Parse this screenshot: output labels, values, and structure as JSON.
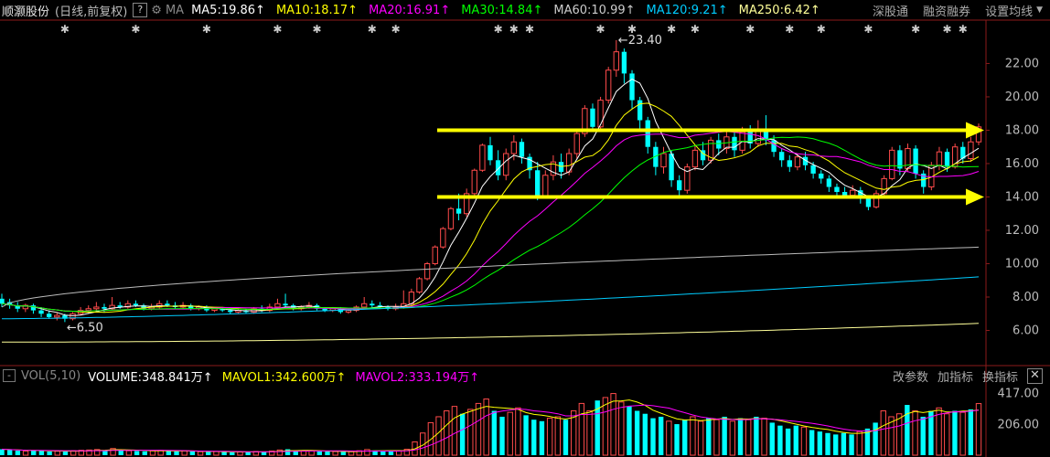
{
  "header": {
    "stock_name": "顺灏股份",
    "period_label": "(日线,前复权)",
    "help_label": "?",
    "gear_icon": "gear-icon",
    "ma_label": "MA",
    "ma_values": [
      {
        "label": "MA5:19.86",
        "color": "#ffffff"
      },
      {
        "label": "MA10:18.17",
        "color": "#ffff00"
      },
      {
        "label": "MA20:16.91",
        "color": "#ff00ff"
      },
      {
        "label": "MA30:14.84",
        "color": "#00ff00"
      },
      {
        "label": "MA60:10.99",
        "color": "#cccccc"
      },
      {
        "label": "MA120:9.21",
        "color": "#00ccff"
      },
      {
        "label": "MA250:6.42",
        "color": "#ffff99"
      }
    ],
    "menu": [
      "深股通",
      "融资融券",
      "设置均线"
    ]
  },
  "volume_header": {
    "collapse_label": "-",
    "label": "VOL(5,10)",
    "values": [
      {
        "label": "VOLUME:348.841万",
        "color": "#ffffff"
      },
      {
        "label": "MAVOL1:342.600万",
        "color": "#ffff00"
      },
      {
        "label": "MAVOL2:333.194万",
        "color": "#ff00ff"
      }
    ],
    "menu": [
      "改参数",
      "加指标",
      "换指标"
    ],
    "close_label": "✕"
  },
  "chart_data": [
    {
      "type": "candlestick",
      "price_axis": {
        "ticks": [
          "22.00",
          "20.00",
          "18.00",
          "16.00",
          "14.00",
          "12.00",
          "10.00",
          "8.00",
          "6.00"
        ],
        "range": [
          4.0,
          24.6
        ]
      },
      "annotations": {
        "high_label": "23.40",
        "low_label": "6.50"
      },
      "channel_lines": [
        {
          "price": 18.0
        },
        {
          "price": 14.0
        }
      ],
      "candles": [
        {
          "o": 7.9,
          "c": 7.6,
          "h": 8.2,
          "l": 7.4
        },
        {
          "o": 7.7,
          "c": 7.5,
          "h": 7.9,
          "l": 7.3
        },
        {
          "o": 7.5,
          "c": 7.3,
          "h": 7.7,
          "l": 7.1
        },
        {
          "o": 7.3,
          "c": 7.5,
          "h": 7.6,
          "l": 7.1
        },
        {
          "o": 7.5,
          "c": 7.2,
          "h": 7.6,
          "l": 7.0
        },
        {
          "o": 7.2,
          "c": 7.0,
          "h": 7.4,
          "l": 6.8
        },
        {
          "o": 7.0,
          "c": 6.8,
          "h": 7.2,
          "l": 6.7
        },
        {
          "o": 6.8,
          "c": 6.9,
          "h": 7.1,
          "l": 6.6
        },
        {
          "o": 6.9,
          "c": 6.7,
          "h": 7.0,
          "l": 6.5
        },
        {
          "o": 6.7,
          "c": 7.0,
          "h": 7.1,
          "l": 6.6
        },
        {
          "o": 7.0,
          "c": 7.2,
          "h": 7.4,
          "l": 6.9
        },
        {
          "o": 7.2,
          "c": 7.3,
          "h": 7.5,
          "l": 7.0
        },
        {
          "o": 7.3,
          "c": 7.4,
          "h": 7.7,
          "l": 7.1
        },
        {
          "o": 7.4,
          "c": 7.3,
          "h": 7.6,
          "l": 7.1
        },
        {
          "o": 7.3,
          "c": 7.5,
          "h": 8.0,
          "l": 7.2
        },
        {
          "o": 7.5,
          "c": 7.4,
          "h": 7.7,
          "l": 7.3
        },
        {
          "o": 7.4,
          "c": 7.6,
          "h": 7.8,
          "l": 7.3
        },
        {
          "o": 7.6,
          "c": 7.5,
          "h": 7.8,
          "l": 7.4
        },
        {
          "o": 7.5,
          "c": 7.3,
          "h": 7.6,
          "l": 7.2
        },
        {
          "o": 7.3,
          "c": 7.4,
          "h": 7.6,
          "l": 7.2
        },
        {
          "o": 7.4,
          "c": 7.6,
          "h": 7.8,
          "l": 7.3
        },
        {
          "o": 7.6,
          "c": 7.5,
          "h": 7.8,
          "l": 7.4
        },
        {
          "o": 7.5,
          "c": 7.4,
          "h": 7.7,
          "l": 7.3
        },
        {
          "o": 7.4,
          "c": 7.5,
          "h": 7.7,
          "l": 7.3
        },
        {
          "o": 7.5,
          "c": 7.3,
          "h": 7.6,
          "l": 7.2
        },
        {
          "o": 7.3,
          "c": 7.4,
          "h": 7.5,
          "l": 7.2
        },
        {
          "o": 7.4,
          "c": 7.2,
          "h": 7.5,
          "l": 7.1
        },
        {
          "o": 7.2,
          "c": 7.3,
          "h": 7.4,
          "l": 7.1
        },
        {
          "o": 7.3,
          "c": 7.2,
          "h": 7.4,
          "l": 7.1
        },
        {
          "o": 7.2,
          "c": 7.1,
          "h": 7.3,
          "l": 7.0
        },
        {
          "o": 7.1,
          "c": 7.2,
          "h": 7.3,
          "l": 7.0
        },
        {
          "o": 7.2,
          "c": 7.1,
          "h": 7.3,
          "l": 7.0
        },
        {
          "o": 7.1,
          "c": 7.3,
          "h": 7.4,
          "l": 7.0
        },
        {
          "o": 7.3,
          "c": 7.2,
          "h": 7.5,
          "l": 7.1
        },
        {
          "o": 7.2,
          "c": 7.4,
          "h": 7.6,
          "l": 7.1
        },
        {
          "o": 7.4,
          "c": 7.6,
          "h": 7.9,
          "l": 7.3
        },
        {
          "o": 7.6,
          "c": 7.5,
          "h": 8.2,
          "l": 7.4
        },
        {
          "o": 7.5,
          "c": 7.3,
          "h": 7.6,
          "l": 7.2
        },
        {
          "o": 7.3,
          "c": 7.4,
          "h": 7.5,
          "l": 7.2
        },
        {
          "o": 7.4,
          "c": 7.5,
          "h": 7.7,
          "l": 7.3
        },
        {
          "o": 7.5,
          "c": 7.3,
          "h": 7.6,
          "l": 7.2
        },
        {
          "o": 7.3,
          "c": 7.2,
          "h": 7.4,
          "l": 7.1
        },
        {
          "o": 7.2,
          "c": 7.3,
          "h": 7.4,
          "l": 7.1
        },
        {
          "o": 7.3,
          "c": 7.1,
          "h": 7.4,
          "l": 7.0
        },
        {
          "o": 7.1,
          "c": 7.2,
          "h": 7.3,
          "l": 7.0
        },
        {
          "o": 7.2,
          "c": 7.4,
          "h": 7.5,
          "l": 7.1
        },
        {
          "o": 7.4,
          "c": 7.6,
          "h": 8.0,
          "l": 7.3
        },
        {
          "o": 7.6,
          "c": 7.5,
          "h": 7.8,
          "l": 7.3
        },
        {
          "o": 7.5,
          "c": 7.4,
          "h": 7.7,
          "l": 7.3
        },
        {
          "o": 7.4,
          "c": 7.3,
          "h": 7.5,
          "l": 7.2
        },
        {
          "o": 7.3,
          "c": 7.4,
          "h": 7.6,
          "l": 7.2
        },
        {
          "o": 7.4,
          "c": 7.6,
          "h": 8.4,
          "l": 7.3
        },
        {
          "o": 7.6,
          "c": 8.3,
          "h": 8.5,
          "l": 7.5
        },
        {
          "o": 8.3,
          "c": 9.1,
          "h": 9.2,
          "l": 8.2
        },
        {
          "o": 9.1,
          "c": 10.0,
          "h": 10.1,
          "l": 9.0
        },
        {
          "o": 10.0,
          "c": 11.0,
          "h": 11.1,
          "l": 9.9
        },
        {
          "o": 11.0,
          "c": 12.1,
          "h": 12.2,
          "l": 10.9
        },
        {
          "o": 12.1,
          "c": 13.3,
          "h": 13.4,
          "l": 12.0
        },
        {
          "o": 13.3,
          "c": 13.0,
          "h": 14.2,
          "l": 12.6
        },
        {
          "o": 13.0,
          "c": 14.2,
          "h": 14.5,
          "l": 12.8
        },
        {
          "o": 14.2,
          "c": 15.6,
          "h": 15.7,
          "l": 14.1
        },
        {
          "o": 15.6,
          "c": 17.1,
          "h": 17.2,
          "l": 15.5
        },
        {
          "o": 17.1,
          "c": 16.2,
          "h": 17.6,
          "l": 15.9
        },
        {
          "o": 16.2,
          "c": 15.3,
          "h": 16.8,
          "l": 15.0
        },
        {
          "o": 15.3,
          "c": 16.6,
          "h": 16.9,
          "l": 15.0
        },
        {
          "o": 16.6,
          "c": 17.3,
          "h": 17.7,
          "l": 16.2
        },
        {
          "o": 17.3,
          "c": 16.4,
          "h": 17.5,
          "l": 16.0
        },
        {
          "o": 16.4,
          "c": 15.6,
          "h": 16.6,
          "l": 15.1
        },
        {
          "o": 15.6,
          "c": 14.0,
          "h": 16.1,
          "l": 13.8
        },
        {
          "o": 14.0,
          "c": 15.3,
          "h": 15.6,
          "l": 13.9
        },
        {
          "o": 15.3,
          "c": 16.1,
          "h": 16.5,
          "l": 15.0
        },
        {
          "o": 16.1,
          "c": 15.5,
          "h": 16.6,
          "l": 15.1
        },
        {
          "o": 15.5,
          "c": 16.6,
          "h": 16.9,
          "l": 15.3
        },
        {
          "o": 16.6,
          "c": 17.8,
          "h": 18.0,
          "l": 16.3
        },
        {
          "o": 17.8,
          "c": 19.3,
          "h": 19.5,
          "l": 17.6
        },
        {
          "o": 19.3,
          "c": 18.2,
          "h": 19.6,
          "l": 17.9
        },
        {
          "o": 18.2,
          "c": 19.8,
          "h": 20.0,
          "l": 18.0
        },
        {
          "o": 19.8,
          "c": 21.6,
          "h": 21.8,
          "l": 19.6
        },
        {
          "o": 21.6,
          "c": 22.7,
          "h": 23.4,
          "l": 21.2
        },
        {
          "o": 22.7,
          "c": 21.4,
          "h": 22.9,
          "l": 20.8
        },
        {
          "o": 21.4,
          "c": 19.8,
          "h": 21.6,
          "l": 19.3
        },
        {
          "o": 19.8,
          "c": 18.6,
          "h": 20.0,
          "l": 18.1
        },
        {
          "o": 18.6,
          "c": 17.0,
          "h": 18.8,
          "l": 16.6
        },
        {
          "o": 17.0,
          "c": 15.8,
          "h": 17.3,
          "l": 15.3
        },
        {
          "o": 15.8,
          "c": 16.6,
          "h": 17.0,
          "l": 15.4
        },
        {
          "o": 16.6,
          "c": 15.0,
          "h": 16.8,
          "l": 14.6
        },
        {
          "o": 15.0,
          "c": 14.4,
          "h": 15.3,
          "l": 14.0
        },
        {
          "o": 14.4,
          "c": 15.8,
          "h": 16.0,
          "l": 14.2
        },
        {
          "o": 15.8,
          "c": 16.8,
          "h": 17.1,
          "l": 15.6
        },
        {
          "o": 16.8,
          "c": 16.2,
          "h": 17.3,
          "l": 15.9
        },
        {
          "o": 16.2,
          "c": 17.4,
          "h": 17.6,
          "l": 16.0
        },
        {
          "o": 17.4,
          "c": 16.9,
          "h": 17.8,
          "l": 16.5
        },
        {
          "o": 16.9,
          "c": 17.6,
          "h": 18.1,
          "l": 16.6
        },
        {
          "o": 17.6,
          "c": 16.8,
          "h": 17.9,
          "l": 16.4
        },
        {
          "o": 16.8,
          "c": 17.9,
          "h": 18.2,
          "l": 16.6
        },
        {
          "o": 17.9,
          "c": 17.2,
          "h": 18.3,
          "l": 16.9
        },
        {
          "o": 17.2,
          "c": 18.0,
          "h": 18.6,
          "l": 17.0
        },
        {
          "o": 18.0,
          "c": 17.4,
          "h": 18.9,
          "l": 17.1
        },
        {
          "o": 17.4,
          "c": 16.7,
          "h": 17.7,
          "l": 16.4
        },
        {
          "o": 16.7,
          "c": 16.2,
          "h": 16.9,
          "l": 15.8
        },
        {
          "o": 16.2,
          "c": 15.8,
          "h": 16.5,
          "l": 15.5
        },
        {
          "o": 15.8,
          "c": 16.4,
          "h": 16.6,
          "l": 15.6
        },
        {
          "o": 16.4,
          "c": 15.9,
          "h": 16.7,
          "l": 15.6
        },
        {
          "o": 15.9,
          "c": 15.4,
          "h": 16.1,
          "l": 15.1
        },
        {
          "o": 15.4,
          "c": 15.1,
          "h": 15.6,
          "l": 14.8
        },
        {
          "o": 15.1,
          "c": 14.6,
          "h": 15.3,
          "l": 14.3
        },
        {
          "o": 14.6,
          "c": 14.3,
          "h": 14.8,
          "l": 14.0
        },
        {
          "o": 14.3,
          "c": 14.1,
          "h": 14.6,
          "l": 13.9
        },
        {
          "o": 14.1,
          "c": 14.4,
          "h": 14.7,
          "l": 13.9
        },
        {
          "o": 14.4,
          "c": 13.9,
          "h": 14.6,
          "l": 13.6
        },
        {
          "o": 13.9,
          "c": 13.4,
          "h": 14.0,
          "l": 13.2
        },
        {
          "o": 13.4,
          "c": 14.2,
          "h": 14.4,
          "l": 13.3
        },
        {
          "o": 14.2,
          "c": 15.1,
          "h": 15.3,
          "l": 14.0
        },
        {
          "o": 15.1,
          "c": 16.8,
          "h": 17.0,
          "l": 15.0
        },
        {
          "o": 16.8,
          "c": 15.7,
          "h": 17.1,
          "l": 15.3
        },
        {
          "o": 15.7,
          "c": 16.9,
          "h": 17.2,
          "l": 15.5
        },
        {
          "o": 16.9,
          "c": 15.4,
          "h": 17.1,
          "l": 15.1
        },
        {
          "o": 15.4,
          "c": 14.6,
          "h": 15.6,
          "l": 14.2
        },
        {
          "o": 14.6,
          "c": 15.9,
          "h": 16.1,
          "l": 14.4
        },
        {
          "o": 15.9,
          "c": 16.7,
          "h": 17.0,
          "l": 15.6
        },
        {
          "o": 16.7,
          "c": 15.8,
          "h": 16.9,
          "l": 15.5
        },
        {
          "o": 15.8,
          "c": 17.0,
          "h": 17.2,
          "l": 15.7
        },
        {
          "o": 17.0,
          "c": 16.3,
          "h": 17.3,
          "l": 16.0
        },
        {
          "o": 16.3,
          "c": 17.3,
          "h": 17.6,
          "l": 16.1
        },
        {
          "o": 17.3,
          "c": 18.2,
          "h": 18.4,
          "l": 17.1
        }
      ],
      "moving_averages": {
        "MA5": {
          "color": "#ffffff",
          "end": 19.86
        },
        "MA10": {
          "color": "#ffff00",
          "end": 18.17
        },
        "MA20": {
          "color": "#ff00ff",
          "end": 16.91
        },
        "MA30": {
          "color": "#00ff00",
          "end": 14.84
        },
        "MA60": {
          "color": "#bbbbbb",
          "end": 10.99
        },
        "MA120": {
          "color": "#00ccff",
          "end": 9.21
        },
        "MA250": {
          "color": "#ffff99",
          "end": 6.42
        }
      }
    },
    {
      "type": "bar",
      "name": "VOL(5,10)",
      "volume_axis": {
        "ticks": [
          "417.00",
          "206.00"
        ],
        "range": [
          0,
          470
        ]
      },
      "unit": "万",
      "values": [
        40,
        35,
        30,
        28,
        32,
        30,
        25,
        27,
        24,
        30,
        33,
        35,
        38,
        32,
        45,
        35,
        30,
        28,
        26,
        30,
        33,
        28,
        26,
        30,
        25,
        24,
        22,
        25,
        23,
        20,
        22,
        21,
        25,
        23,
        28,
        35,
        40,
        30,
        28,
        30,
        26,
        24,
        25,
        23,
        24,
        30,
        38,
        32,
        28,
        26,
        30,
        40,
        90,
        150,
        220,
        260,
        300,
        330,
        280,
        310,
        350,
        380,
        300,
        260,
        290,
        320,
        270,
        240,
        230,
        250,
        260,
        240,
        300,
        350,
        300,
        370,
        390,
        417,
        360,
        330,
        300,
        280,
        250,
        260,
        230,
        210,
        240,
        260,
        230,
        250,
        240,
        260,
        230,
        250,
        240,
        260,
        250,
        220,
        200,
        180,
        200,
        190,
        170,
        160,
        150,
        140,
        150,
        140,
        160,
        180,
        220,
        300,
        260,
        280,
        340,
        300,
        260,
        300,
        320,
        280,
        300,
        290,
        310,
        349
      ]
    }
  ]
}
